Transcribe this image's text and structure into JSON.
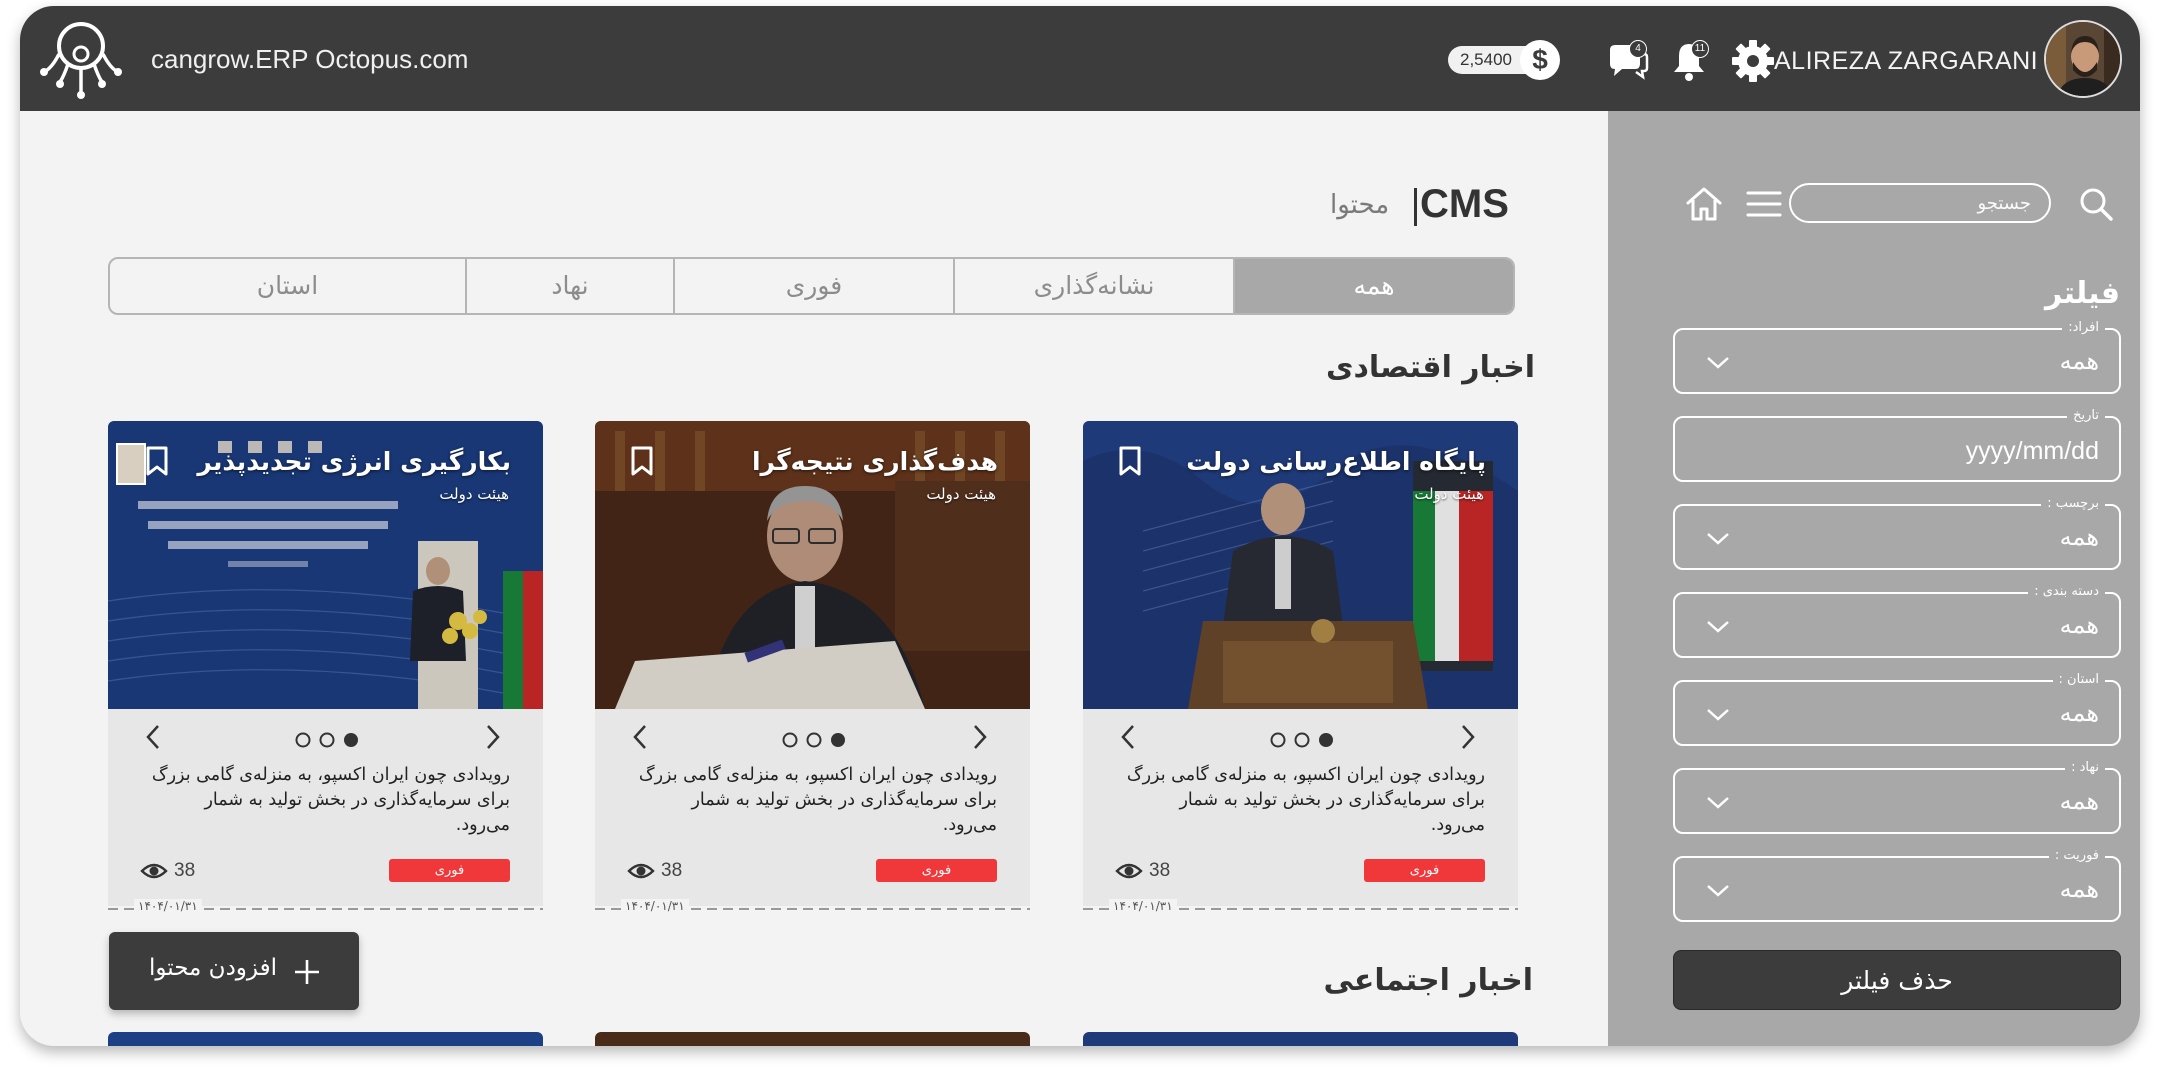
{
  "header": {
    "brand": "cangrow.ERP Octopus.com",
    "balance": "2,5400",
    "currency_symbol": "$",
    "messages_count": "4",
    "notifications_count": "11",
    "user_name": "ALIREZA ZARGARANI"
  },
  "sidebar": {
    "search_placeholder": "جستجو",
    "filter_title": "فیلتر",
    "fields": [
      {
        "label": "افراد:",
        "value": "همه"
      },
      {
        "label": "تاریخ",
        "value": "yyyy/mm/dd"
      },
      {
        "label": "برچسب :",
        "value": "همه"
      },
      {
        "label": "دسته بندی :",
        "value": "همه"
      },
      {
        "label": "استان :",
        "value": "همه"
      },
      {
        "label": "نهاد :",
        "value": "همه"
      },
      {
        "label": "فوریت :",
        "value": "همه"
      }
    ],
    "clear_button": "حذف فیلتر"
  },
  "main": {
    "title": "CMS",
    "subtitle": "محتوا",
    "tabs": [
      {
        "label": "همه",
        "active": true
      },
      {
        "label": "نشانه‌گذاری",
        "active": false
      },
      {
        "label": "فوری",
        "active": false
      },
      {
        "label": "نهاد",
        "active": false
      },
      {
        "label": "استان",
        "active": false
      }
    ],
    "section_economic": "اخبار اقتصادی",
    "section_social": "اخبار اجتماعی",
    "add_button": "افزودن محتوا",
    "cards": [
      {
        "title": "پایگاه اطلاع‌رسانی دولت",
        "source": "هیئت دولت",
        "text": "رویدادی چون ایران اکسپو، به منزله‌ی گامی بزرگ برای سرمایه‌گذاری در بخش تولید به شمار می‌رود.",
        "views": "38",
        "tag": "فوری",
        "date": "۱۴۰۴/۰۱/۳۱"
      },
      {
        "title": "هدف‌گذاری نتیجه‌گرا",
        "source": "هیئت دولت",
        "text": "رویدادی چون ایران اکسپو، به منزله‌ی گامی بزرگ برای سرمایه‌گذاری در بخش تولید به شمار می‌رود.",
        "views": "38",
        "tag": "فوری",
        "date": "۱۴۰۴/۰۱/۳۱"
      },
      {
        "title": "بکارگیری انرژی تجدیدپذیر",
        "source": "هیئت دولت",
        "text": "رویدادی چون ایران اکسپو، به منزله‌ی گامی بزرگ برای سرمایه‌گذاری در بخش تولید به شمار می‌رود.",
        "views": "38",
        "tag": "فوری",
        "date": "۱۴۰۴/۰۱/۳۱"
      }
    ]
  },
  "colors": {
    "topbar": "#3c3c3c",
    "sidebar": "#a8a8a8",
    "urgent_tag": "#f0373a",
    "page_bg": "#f3f3f3"
  },
  "icons": {
    "logo": "octopus-logo-icon",
    "messages": "chat-icon",
    "notifications": "bell-icon",
    "settings": "gear-icon",
    "search": "search-icon",
    "menu": "menu-icon",
    "home": "home-icon",
    "bookmark": "bookmark-icon",
    "views": "eye-icon",
    "add": "plus-icon"
  }
}
